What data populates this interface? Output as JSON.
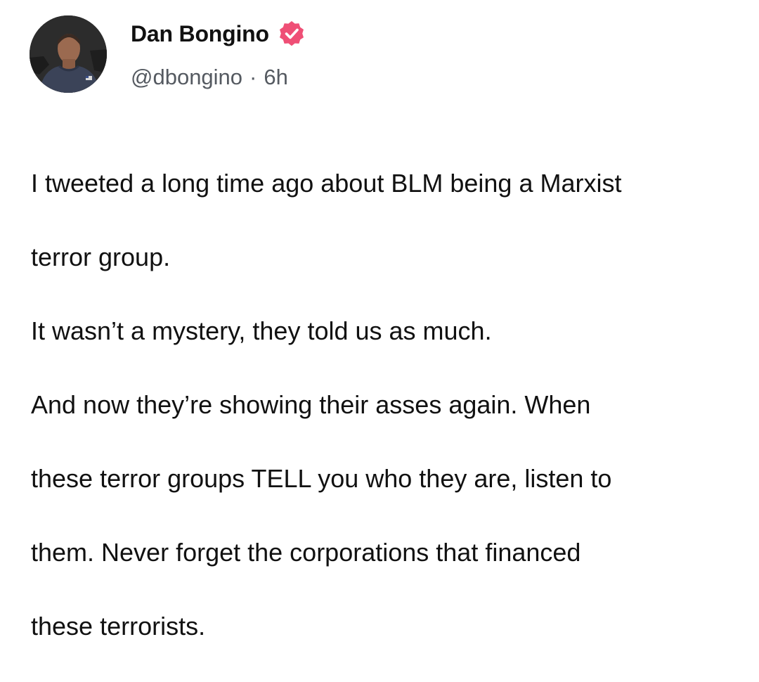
{
  "post": {
    "author": {
      "display_name": "Dan Bongino",
      "handle": "@dbongino",
      "avatar_icon": "profile-photo",
      "verified_icon": "verified-badge-icon",
      "verified_color": "#ef4f76"
    },
    "meta": {
      "separator": "·",
      "time_ago": "6h"
    },
    "lines": [
      "I tweeted a long time ago about BLM being a Marxist",
      "terror group.",
      "It wasn’t a mystery, they told us as much.",
      "And now they’re showing their asses again. When",
      "these terror groups TELL you who they are, listen to",
      "them. Never forget the corporations that financed",
      "these terrorists."
    ]
  }
}
